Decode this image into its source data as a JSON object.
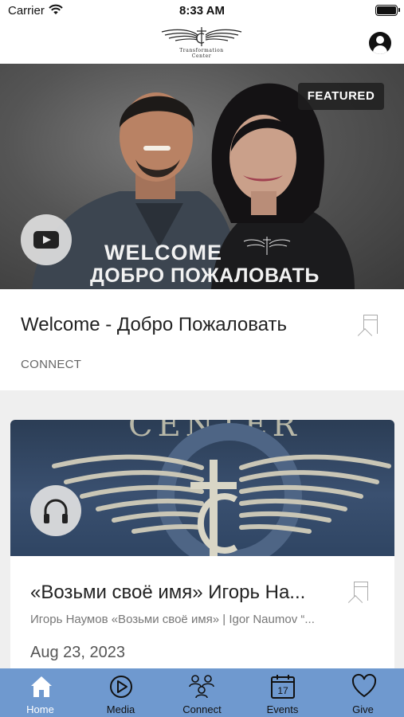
{
  "status_bar": {
    "carrier": "Carrier",
    "time": "8:33 AM"
  },
  "header": {
    "logo_text_line1": "Transformation",
    "logo_text_line2": "Center"
  },
  "featured": {
    "badge": "FEATURED",
    "hero_line1": "WELCOME",
    "hero_line2": "ДОБРО ПОЖАЛОВАТЬ",
    "title": "Welcome - Добро Пожаловать",
    "category": "CONNECT"
  },
  "card2": {
    "image_text": "CENTER",
    "title": "«Возьми своё имя» Игорь На...",
    "subtitle": "Игорь Наумов «Возьми своё имя» | Igor Naumov “...",
    "date": "Aug 23, 2023"
  },
  "tabs": [
    {
      "label": "Home",
      "icon": "home-icon",
      "active": true
    },
    {
      "label": "Media",
      "icon": "play-circle-icon",
      "active": false
    },
    {
      "label": "Connect",
      "icon": "people-icon",
      "active": false
    },
    {
      "label": "Events",
      "icon": "calendar-icon",
      "active": false,
      "calendar_day": "17"
    },
    {
      "label": "Give",
      "icon": "heart-icon",
      "active": false
    }
  ],
  "colors": {
    "tab_bar": "#6f99cf",
    "badge_bg": "#1e1e1e"
  }
}
